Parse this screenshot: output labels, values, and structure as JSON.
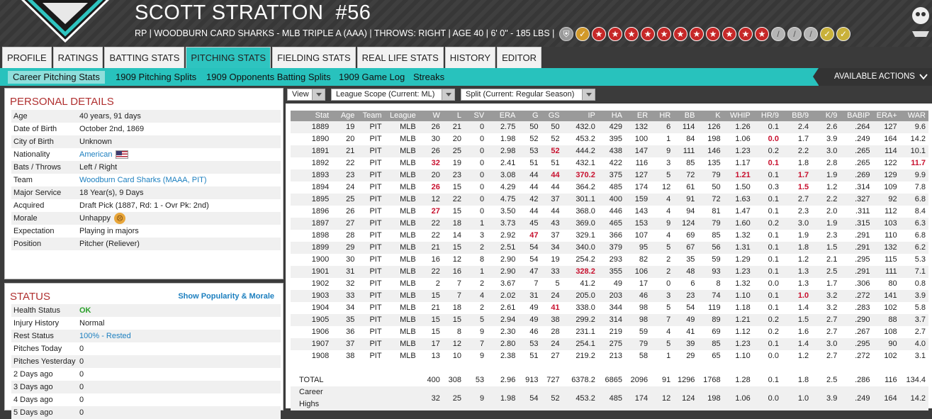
{
  "player": {
    "name": "SCOTT STRATTON",
    "number": "#56",
    "info": "RP | WOODBURN CARD SHARKS - MLB TRIPLE A (AAA)  |  THROWS: RIGHT  |  AGE 40  |  6' 0\" - 185 LBS  |"
  },
  "ratings_icons": [
    "shield",
    "trophy",
    "star",
    "star",
    "star",
    "star",
    "star",
    "star",
    "star",
    "star",
    "star",
    "star",
    "star",
    "bat",
    "bat",
    "bat",
    "glove",
    "glove"
  ],
  "tabs": [
    "PROFILE",
    "RATINGS",
    "BATTING STATS",
    "PITCHING STATS",
    "FIELDING STATS",
    "REAL LIFE STATS",
    "HISTORY",
    "EDITOR"
  ],
  "active_tab": "PITCHING STATS",
  "subtabs": [
    "Career Pitching Stats",
    "1909 Pitching Splits",
    "1909 Opponents Batting Splits",
    "1909 Game Log",
    "Streaks"
  ],
  "available_actions": "AVAILABLE ACTIONS",
  "personal": {
    "title": "PERSONAL DETAILS",
    "rows": [
      {
        "k": "Age",
        "v": "40 years, 91 days"
      },
      {
        "k": "Date of Birth",
        "v": "October 2nd, 1869"
      },
      {
        "k": "City of Birth",
        "v": "Unknown"
      },
      {
        "k": "Nationality",
        "v": "American",
        "link": true,
        "flag": true
      },
      {
        "k": "Bats / Throws",
        "v": "Left / Right"
      },
      {
        "k": "Team",
        "v": "Woodburn Card Sharks (MAAA, PIT)",
        "link": true
      },
      {
        "k": "Major Service",
        "v": "18 Year(s), 9 Days"
      },
      {
        "k": "Acquired",
        "v": "Draft Pick (1887, Rd: 1 - Ovr Pk: 2nd)"
      },
      {
        "k": "Morale",
        "v": "Unhappy",
        "face": true
      },
      {
        "k": "Expectation",
        "v": "Playing in majors"
      },
      {
        "k": "Position",
        "v": "Pitcher (Reliever)"
      }
    ]
  },
  "status": {
    "title": "STATUS",
    "link": "Show Popularity & Morale",
    "rows": [
      {
        "k": "Health Status",
        "v": "OK",
        "ok": true
      },
      {
        "k": "Injury History",
        "v": "Normal"
      },
      {
        "k": "Rest Status",
        "v": "100% - Rested",
        "link": true
      },
      {
        "k": "Pitches Today",
        "v": "0"
      },
      {
        "k": "Pitches Yesterday",
        "v": "0"
      },
      {
        "k": "2 Days ago",
        "v": "0"
      },
      {
        "k": "3 Days ago",
        "v": "0"
      },
      {
        "k": "4 Days ago",
        "v": "0"
      },
      {
        "k": "5 Days ago",
        "v": "0"
      }
    ]
  },
  "filters": {
    "view": "View",
    "scope": "League Scope  (Current: ML)",
    "split": "Split  (Current: Regular Season)"
  },
  "table": {
    "headers": [
      "Stat",
      "Age",
      "Team",
      "League",
      "W",
      "L",
      "SV",
      "ERA",
      "G",
      "GS",
      "IP",
      "HA",
      "ER",
      "HR",
      "BB",
      "K",
      "WHIP",
      "HR/9",
      "BB/9",
      "K/9",
      "BABIP",
      "ERA+",
      "WAR"
    ],
    "rows": [
      [
        "1889",
        "19",
        "PIT",
        "MLB",
        "26",
        "21",
        "0",
        "2.75",
        "50",
        "50",
        "432.0",
        "429",
        "132",
        "6",
        "114",
        "126",
        "1.26",
        "0.1",
        "2.4",
        "2.6",
        ".264",
        "127",
        "9.6"
      ],
      [
        "1890",
        "20",
        "PIT",
        "MLB",
        "30",
        "20",
        "0",
        "1.98",
        "52",
        "52",
        "453.2",
        "395",
        "100",
        "1",
        "84",
        "198",
        "1.06",
        "0.0",
        "1.7",
        "3.9",
        ".249",
        "164",
        "14.2"
      ],
      [
        "1891",
        "21",
        "PIT",
        "MLB",
        "26",
        "25",
        "0",
        "2.98",
        "53",
        "52",
        "444.2",
        "438",
        "147",
        "9",
        "111",
        "146",
        "1.23",
        "0.2",
        "2.2",
        "3.0",
        ".265",
        "114",
        "10.1"
      ],
      [
        "1892",
        "22",
        "PIT",
        "MLB",
        "32",
        "19",
        "0",
        "2.41",
        "51",
        "51",
        "432.1",
        "422",
        "116",
        "3",
        "85",
        "135",
        "1.17",
        "0.1",
        "1.8",
        "2.8",
        ".265",
        "122",
        "11.7"
      ],
      [
        "1893",
        "23",
        "PIT",
        "MLB",
        "20",
        "23",
        "0",
        "3.08",
        "44",
        "44",
        "370.2",
        "375",
        "127",
        "5",
        "72",
        "79",
        "1.21",
        "0.1",
        "1.7",
        "1.9",
        ".269",
        "129",
        "9.9"
      ],
      [
        "1894",
        "24",
        "PIT",
        "MLB",
        "26",
        "15",
        "0",
        "4.29",
        "44",
        "44",
        "364.2",
        "485",
        "174",
        "12",
        "61",
        "50",
        "1.50",
        "0.3",
        "1.5",
        "1.2",
        ".314",
        "109",
        "7.8"
      ],
      [
        "1895",
        "25",
        "PIT",
        "MLB",
        "12",
        "22",
        "0",
        "4.75",
        "42",
        "37",
        "301.1",
        "400",
        "159",
        "4",
        "91",
        "72",
        "1.63",
        "0.1",
        "2.7",
        "2.2",
        ".327",
        "92",
        "6.8"
      ],
      [
        "1896",
        "26",
        "PIT",
        "MLB",
        "27",
        "15",
        "0",
        "3.50",
        "44",
        "44",
        "368.0",
        "446",
        "143",
        "4",
        "94",
        "81",
        "1.47",
        "0.1",
        "2.3",
        "2.0",
        ".311",
        "112",
        "8.4"
      ],
      [
        "1897",
        "27",
        "PIT",
        "MLB",
        "22",
        "18",
        "1",
        "3.73",
        "45",
        "43",
        "369.0",
        "465",
        "153",
        "9",
        "124",
        "79",
        "1.60",
        "0.2",
        "3.0",
        "1.9",
        ".315",
        "103",
        "6.3"
      ],
      [
        "1898",
        "28",
        "PIT",
        "MLB",
        "22",
        "14",
        "3",
        "2.92",
        "47",
        "37",
        "329.1",
        "366",
        "107",
        "4",
        "69",
        "85",
        "1.32",
        "0.1",
        "1.9",
        "2.3",
        ".291",
        "110",
        "6.8"
      ],
      [
        "1899",
        "29",
        "PIT",
        "MLB",
        "21",
        "15",
        "2",
        "2.51",
        "54",
        "34",
        "340.0",
        "379",
        "95",
        "5",
        "67",
        "56",
        "1.31",
        "0.1",
        "1.8",
        "1.5",
        ".291",
        "132",
        "6.2"
      ],
      [
        "1900",
        "30",
        "PIT",
        "MLB",
        "16",
        "12",
        "8",
        "2.90",
        "54",
        "19",
        "254.2",
        "293",
        "82",
        "2",
        "35",
        "59",
        "1.29",
        "0.1",
        "1.2",
        "2.1",
        ".295",
        "115",
        "5.3"
      ],
      [
        "1901",
        "31",
        "PIT",
        "MLB",
        "22",
        "16",
        "1",
        "2.90",
        "47",
        "33",
        "328.2",
        "355",
        "106",
        "2",
        "48",
        "93",
        "1.23",
        "0.1",
        "1.3",
        "2.5",
        ".291",
        "111",
        "7.1"
      ],
      [
        "1902",
        "32",
        "PIT",
        "MLB",
        "2",
        "7",
        "2",
        "3.67",
        "7",
        "5",
        "41.2",
        "49",
        "17",
        "0",
        "6",
        "8",
        "1.32",
        "0.0",
        "1.3",
        "1.7",
        ".306",
        "80",
        "0.8"
      ],
      [
        "1903",
        "33",
        "PIT",
        "MLB",
        "15",
        "7",
        "4",
        "2.02",
        "31",
        "24",
        "205.0",
        "203",
        "46",
        "3",
        "23",
        "74",
        "1.10",
        "0.1",
        "1.0",
        "3.2",
        ".272",
        "141",
        "3.9"
      ],
      [
        "1904",
        "34",
        "PIT",
        "MLB",
        "21",
        "18",
        "2",
        "2.61",
        "49",
        "41",
        "338.0",
        "344",
        "98",
        "5",
        "54",
        "119",
        "1.18",
        "0.1",
        "1.4",
        "3.2",
        ".283",
        "102",
        "5.8"
      ],
      [
        "1905",
        "35",
        "PIT",
        "MLB",
        "15",
        "15",
        "5",
        "2.94",
        "49",
        "38",
        "299.2",
        "314",
        "98",
        "7",
        "49",
        "89",
        "1.21",
        "0.2",
        "1.5",
        "2.7",
        ".290",
        "88",
        "3.7"
      ],
      [
        "1906",
        "36",
        "PIT",
        "MLB",
        "15",
        "8",
        "9",
        "2.30",
        "46",
        "28",
        "231.1",
        "219",
        "59",
        "4",
        "41",
        "69",
        "1.12",
        "0.2",
        "1.6",
        "2.7",
        ".267",
        "108",
        "2.7"
      ],
      [
        "1907",
        "37",
        "PIT",
        "MLB",
        "17",
        "12",
        "7",
        "2.80",
        "53",
        "24",
        "254.1",
        "275",
        "79",
        "5",
        "39",
        "85",
        "1.23",
        "0.1",
        "1.4",
        "3.0",
        ".295",
        "90",
        "4.0"
      ],
      [
        "1908",
        "38",
        "PIT",
        "MLB",
        "13",
        "10",
        "9",
        "2.38",
        "51",
        "27",
        "219.2",
        "213",
        "58",
        "1",
        "29",
        "65",
        "1.10",
        "0.0",
        "1.2",
        "2.7",
        ".272",
        "102",
        "3.1"
      ]
    ],
    "red_cells": [
      [
        1,
        17
      ],
      [
        3,
        4
      ],
      [
        3,
        17
      ],
      [
        3,
        22
      ],
      [
        4,
        9
      ],
      [
        4,
        10
      ],
      [
        4,
        16
      ],
      [
        4,
        18
      ],
      [
        5,
        4
      ],
      [
        5,
        18
      ],
      [
        7,
        4
      ],
      [
        9,
        8
      ],
      [
        12,
        10
      ],
      [
        14,
        18
      ],
      [
        2,
        9
      ],
      [
        15,
        9
      ]
    ],
    "total": [
      "TOTAL",
      "",
      "",
      "",
      "400",
      "308",
      "53",
      "2.96",
      "913",
      "727",
      "6378.2",
      "6865",
      "2096",
      "91",
      "1296",
      "1768",
      "1.28",
      "0.1",
      "1.8",
      "2.5",
      ".286",
      "116",
      "134.4"
    ],
    "highs": [
      "Career Highs",
      "",
      "",
      "",
      "32",
      "25",
      "9",
      "1.98",
      "54",
      "52",
      "453.2",
      "485",
      "174",
      "12",
      "124",
      "198",
      "1.06",
      "0.0",
      "1.0",
      "3.9",
      ".249",
      "164",
      "14.2"
    ]
  }
}
